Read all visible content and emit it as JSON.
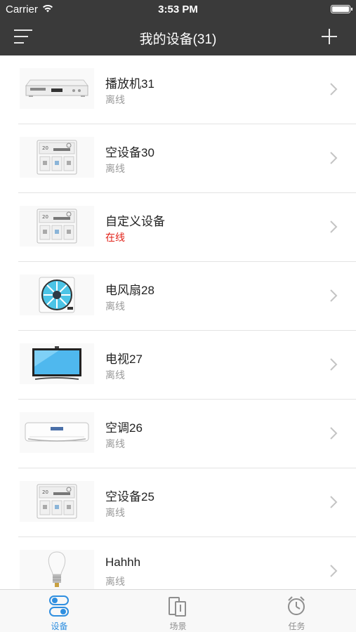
{
  "status_bar": {
    "carrier": "Carrier",
    "time": "3:53 PM"
  },
  "nav": {
    "title": "我的设备(31)",
    "menu_icon": "hamburger-menu-icon",
    "add_icon": "plus-icon"
  },
  "devices": [
    {
      "name": "播放机31",
      "status": "离线",
      "online": false,
      "icon": "dvd-player"
    },
    {
      "name": "空设备30",
      "status": "离线",
      "online": false,
      "icon": "control-panel"
    },
    {
      "name": "自定义设备",
      "status": "在线",
      "online": true,
      "icon": "control-panel"
    },
    {
      "name": "电风扇28",
      "status": "离线",
      "online": false,
      "icon": "fan"
    },
    {
      "name": "电视27",
      "status": "离线",
      "online": false,
      "icon": "tv"
    },
    {
      "name": "空调26",
      "status": "离线",
      "online": false,
      "icon": "air-conditioner"
    },
    {
      "name": "空设备25",
      "status": "离线",
      "online": false,
      "icon": "control-panel"
    },
    {
      "name": "Hahhh",
      "status": "离线",
      "online": false,
      "icon": "light-bulb"
    }
  ],
  "tabs": [
    {
      "label": "设备",
      "icon": "devices-toggle-icon",
      "active": true
    },
    {
      "label": "场景",
      "icon": "scene-icon",
      "active": false
    },
    {
      "label": "任务",
      "icon": "alarm-clock-icon",
      "active": false
    }
  ],
  "colors": {
    "nav_bg": "#3a3a3a",
    "online": "#e2231a",
    "offline": "#9a9a9a",
    "tab_active": "#2f8fe0"
  }
}
